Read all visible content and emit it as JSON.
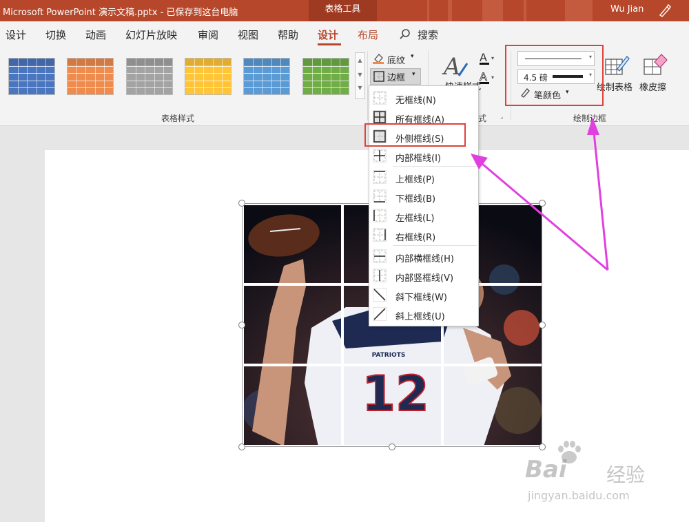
{
  "titlebar": {
    "title": "Microsoft PowerPoint 演示文稿.pptx  -  已保存到这台电脑",
    "context_tab": "表格工具",
    "user": "Wu Jian"
  },
  "tabs": [
    "设计",
    "切换",
    "动画",
    "幻灯片放映",
    "审阅",
    "视图",
    "帮助",
    "设计",
    "布局"
  ],
  "search": {
    "label": "搜索"
  },
  "ribbon": {
    "table_styles": {
      "label": "表格样式",
      "colors": [
        "#4a76c0",
        "#ef8b4d",
        "#a3a3a3",
        "#ffc537",
        "#5b9bd5",
        "#70ad47"
      ],
      "shading": "底纹",
      "borders": "边框"
    },
    "wordart": {
      "quick_styles": "快速样式",
      "label_tail": "式"
    },
    "draw_borders": {
      "label": "绘制边框",
      "pen_weight": "4.5 磅",
      "pen_color": "笔颜色",
      "draw_table": "绘制表格",
      "eraser": "橡皮擦"
    }
  },
  "border_menu": {
    "items": [
      {
        "label": "无框线(N)",
        "icon": "no-border-icon"
      },
      {
        "label": "所有框线(A)",
        "icon": "all-borders-icon"
      },
      {
        "label": "外侧框线(S)",
        "icon": "outside-borders-icon"
      },
      {
        "label": "内部框线(I)",
        "icon": "inside-borders-icon"
      },
      {
        "label": "上框线(P)",
        "icon": "top-border-icon"
      },
      {
        "label": "下框线(B)",
        "icon": "bottom-border-icon"
      },
      {
        "label": "左框线(L)",
        "icon": "left-border-icon"
      },
      {
        "label": "右框线(R)",
        "icon": "right-border-icon"
      },
      {
        "label": "内部横框线(H)",
        "icon": "inside-horizontal-border-icon"
      },
      {
        "label": "内部竖框线(V)",
        "icon": "inside-vertical-border-icon"
      },
      {
        "label": "斜下框线(W)",
        "icon": "diagonal-down-border-icon"
      },
      {
        "label": "斜上框线(U)",
        "icon": "diagonal-up-border-icon"
      }
    ]
  },
  "slide_image": {
    "jersey_text": "PATRIOTS",
    "number": "12"
  },
  "watermark": {
    "brand": "Bai",
    "brand2": "经验",
    "url": "jingyan.baidu.com"
  },
  "colors": {
    "accent": "#b7472a",
    "highlight_box": "#e0413b",
    "arrow": "#e040e0"
  }
}
